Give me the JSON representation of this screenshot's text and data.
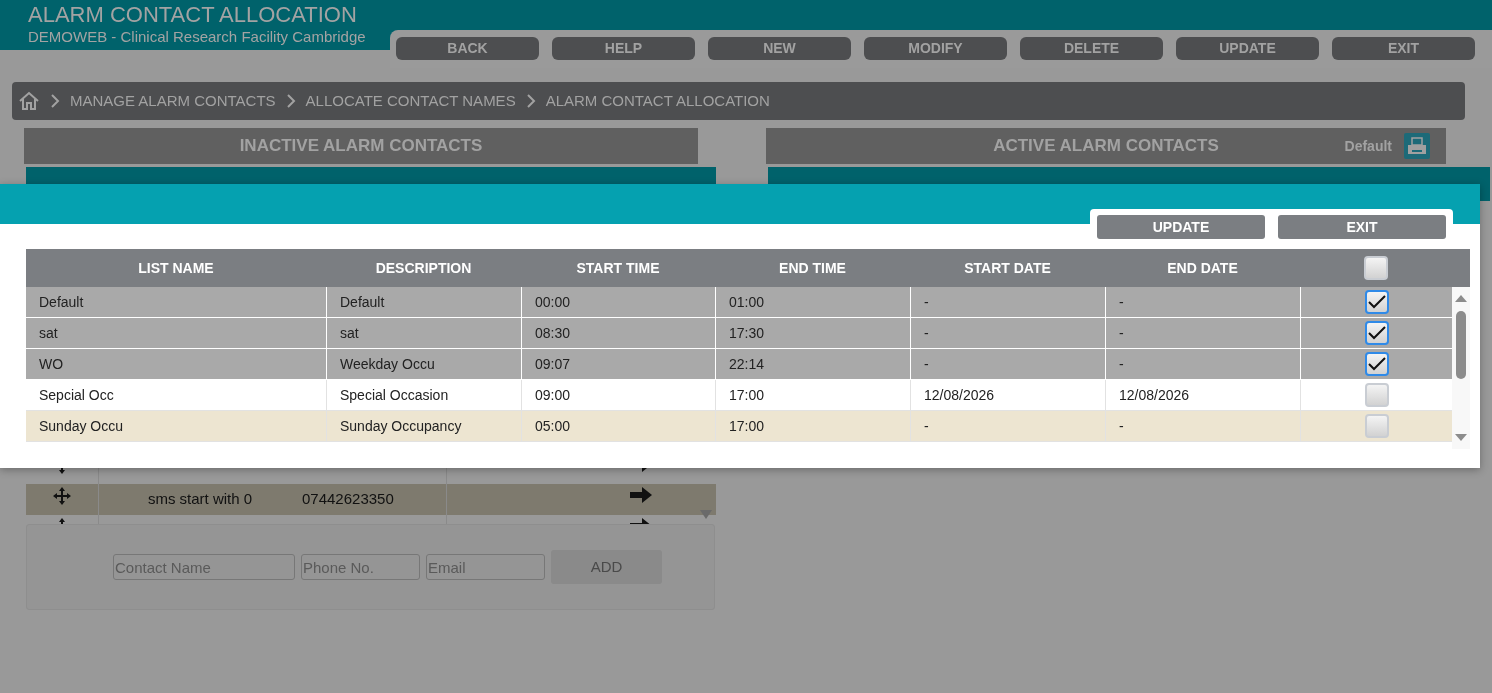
{
  "app": {
    "title": "ALARM CONTACT ALLOCATION",
    "subtitle": "DEMOWEB - Clinical Research Facility Cambridge"
  },
  "toolbar": [
    "BACK",
    "HELP",
    "NEW",
    "MODIFY",
    "DELETE",
    "UPDATE",
    "EXIT"
  ],
  "breadcrumb": [
    "MANAGE ALARM CONTACTS",
    "ALLOCATE CONTACT NAMES",
    "ALARM CONTACT ALLOCATION"
  ],
  "inactive_panel": {
    "title": "INACTIVE ALARM CONTACTS",
    "rows": [
      {
        "highlighted": false
      },
      {
        "name": "sms start with 0",
        "phone": "07442623350",
        "highlighted": true
      },
      {
        "highlighted": false
      }
    ],
    "add_form": {
      "fields": [
        {
          "placeholder": "Contact Name"
        },
        {
          "placeholder": "Phone No."
        },
        {
          "placeholder": "Email"
        }
      ],
      "button": "ADD"
    }
  },
  "active_panel": {
    "title": "ACTIVE ALARM CONTACTS",
    "list_label": "Default"
  },
  "dialog": {
    "buttons": [
      "UPDATE",
      "EXIT"
    ],
    "columns": [
      "LIST NAME",
      "DESCRIPTION",
      "START TIME",
      "END TIME",
      "START DATE",
      "END DATE"
    ],
    "select_all_checked": false,
    "rows": [
      {
        "list_name": "Default",
        "description": "Default",
        "start_time": "00:00",
        "end_time": "01:00",
        "start_date": "-",
        "end_date": "-",
        "checked": true,
        "highlighted": false
      },
      {
        "list_name": "sat",
        "description": "sat",
        "start_time": "08:30",
        "end_time": "17:30",
        "start_date": "-",
        "end_date": "-",
        "checked": true,
        "highlighted": false
      },
      {
        "list_name": "WO",
        "description": "Weekday Occu",
        "start_time": "09:07",
        "end_time": "22:14",
        "start_date": "-",
        "end_date": "-",
        "checked": true,
        "highlighted": false
      },
      {
        "list_name": "Sepcial Occ",
        "description": "Special Occasion",
        "start_time": "09:00",
        "end_time": "17:00",
        "start_date": "12/08/2026",
        "end_date": "12/08/2026",
        "checked": false,
        "highlighted": false
      },
      {
        "list_name": "Sunday Occu",
        "description": "Sunday Occupancy",
        "start_time": "05:00",
        "end_time": "17:00",
        "start_date": "-",
        "end_date": "-",
        "checked": false,
        "highlighted": true
      }
    ]
  }
}
